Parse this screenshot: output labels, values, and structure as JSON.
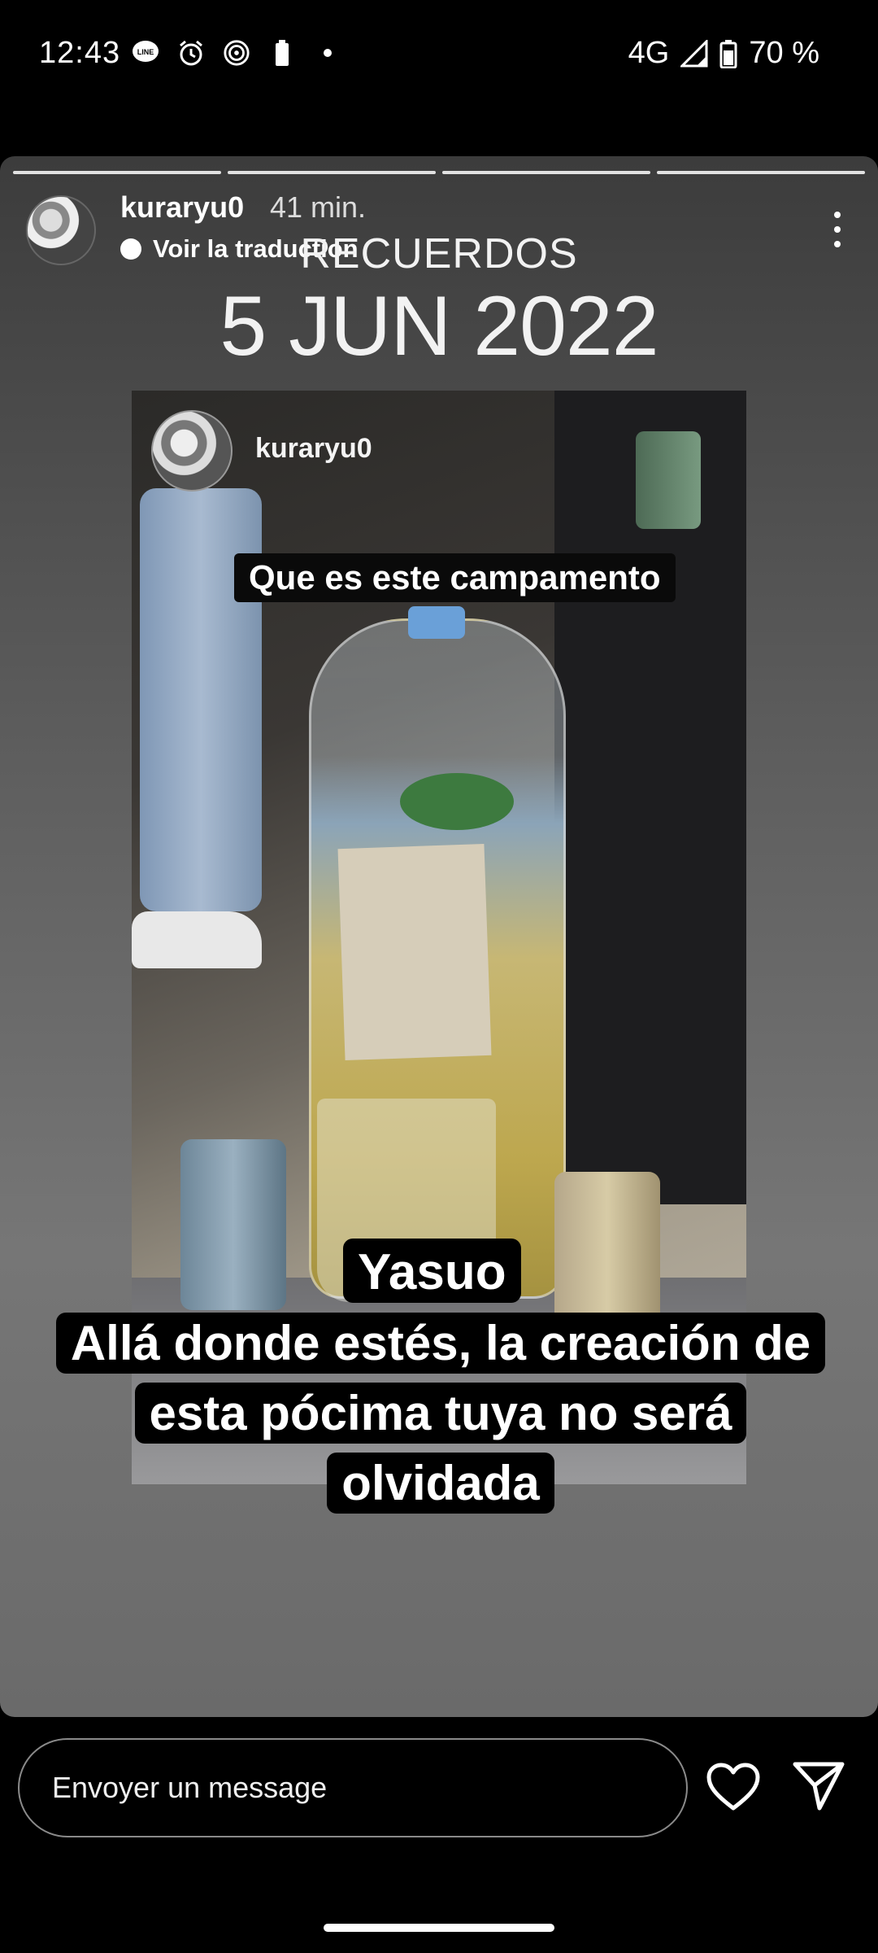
{
  "status_bar": {
    "time": "12:43",
    "network": "4G",
    "battery": "70 %",
    "left_icons": [
      "line-icon",
      "alarm-icon",
      "hotspot-icon",
      "battery-saver-icon",
      "dot-icon"
    ]
  },
  "story": {
    "progress_segments": 4,
    "username": "kuraryu0",
    "time_ago": "41 min.",
    "translate_label": "Voir la traduction",
    "memory_title": "RECUERDOS",
    "memory_date": "5 JUN 2022",
    "inner_username": "kuraryu0",
    "caption_top": "Que es este campamento",
    "caption_name": "Yasuo",
    "caption_body": "Allá donde estés, la creación de esta pócima tuya no será olvidada"
  },
  "footer": {
    "message_placeholder": "Envoyer un message",
    "like_icon": "heart-icon",
    "share_icon": "send-icon"
  }
}
